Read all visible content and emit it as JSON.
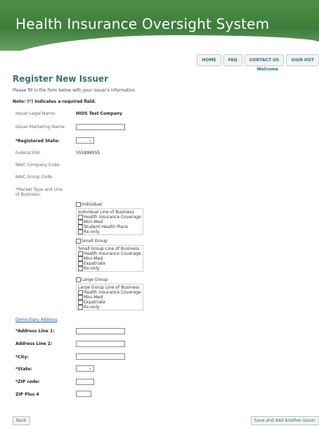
{
  "header": {
    "title": "Health Insurance Oversight System"
  },
  "nav": {
    "home": "HOME",
    "faq": "FAQ",
    "contact": "CONTACT US",
    "signout": "SIGN OUT",
    "welcome": "Welcome"
  },
  "page": {
    "title": "Register New Issuer",
    "intro": "Please fill in the form below with your issuer's information.",
    "note": "Note: (*) Indicates a required field."
  },
  "form": {
    "legal_name_label": "Issuer Legal Name:",
    "legal_name_value": "HIOS Test Company",
    "marketing_name_label": "Issuer Marketing Name:",
    "registered_state_label": "*Registered State:",
    "federal_ein_label": "Federal EIN:",
    "federal_ein_value": "555999555",
    "naic_company_label": "NAIC Company Code:",
    "naic_group_label": "NAIC Group Code:",
    "market_type_label_1": "*Market Type and Line",
    "market_type_label_2": "of Business:",
    "select_arrow": "⌄"
  },
  "market": {
    "individual": "Individual",
    "individual_group_head": "Individual Line of Business",
    "individual_items": [
      "Health Insurance Coverage",
      "Mini-Med",
      "Student Health Plans",
      "Rx-only"
    ],
    "small_group": "Small Group",
    "small_group_head": "Small Group Line of Business",
    "small_items": [
      "Health Insurance Coverage",
      "Mini-Med",
      "Expatriate",
      "Rx-only"
    ],
    "large_group": "Large Group",
    "large_group_head": "Large Group Line of Business",
    "large_items": [
      "Health Insurance Coverage",
      "Mini-Med",
      "Expatriate",
      "Rx-only"
    ]
  },
  "address": {
    "link": "Domiciliary Address",
    "line1_label": "*Address Line 1:",
    "line2_label": "Address Line 2:",
    "city_label": "*City:",
    "state_label": "*State:",
    "zip_label": "*ZIP code:",
    "zip4_label": "ZIP Plus 4"
  },
  "footer": {
    "back": "Back",
    "save_add": "Save and Add Another Issuer"
  }
}
